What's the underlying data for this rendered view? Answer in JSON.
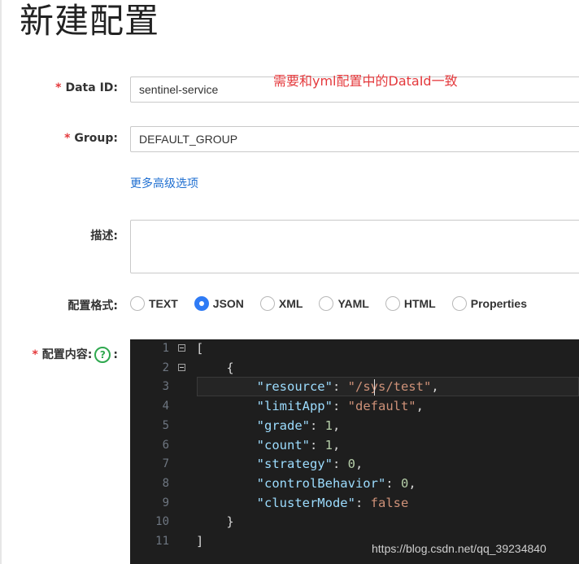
{
  "page": {
    "title": "新建配置"
  },
  "form": {
    "data_id": {
      "label": "Data ID:",
      "value": "sentinel-service"
    },
    "annotation": "需要和yml配置中的DataId一致",
    "group": {
      "label": "Group:",
      "value": "DEFAULT_GROUP"
    },
    "advanced_link": "更多高级选项",
    "description": {
      "label": "描述:",
      "value": ""
    },
    "format": {
      "label": "配置格式:",
      "selected": "JSON",
      "options": [
        "TEXT",
        "JSON",
        "XML",
        "YAML",
        "HTML",
        "Properties"
      ]
    },
    "content": {
      "label": "配置内容:",
      "help": "?",
      "colon": ":"
    }
  },
  "editor": {
    "line_numbers": [
      "1",
      "2",
      "3",
      "4",
      "5",
      "6",
      "7",
      "8",
      "9",
      "10",
      "11"
    ],
    "lines": [
      [
        {
          "t": "[",
          "c": "punc"
        }
      ],
      [
        {
          "t": "    {",
          "c": "punc"
        }
      ],
      [
        {
          "t": "        ",
          "c": "punc"
        },
        {
          "t": "\"resource\"",
          "c": "key"
        },
        {
          "t": ": ",
          "c": "punc"
        },
        {
          "t": "\"/sys/test\"",
          "c": "str"
        },
        {
          "t": ",",
          "c": "punc"
        }
      ],
      [
        {
          "t": "        ",
          "c": "punc"
        },
        {
          "t": "\"limitApp\"",
          "c": "key"
        },
        {
          "t": ": ",
          "c": "punc"
        },
        {
          "t": "\"default\"",
          "c": "str"
        },
        {
          "t": ",",
          "c": "punc"
        }
      ],
      [
        {
          "t": "        ",
          "c": "punc"
        },
        {
          "t": "\"grade\"",
          "c": "key"
        },
        {
          "t": ": ",
          "c": "punc"
        },
        {
          "t": "1",
          "c": "num"
        },
        {
          "t": ",",
          "c": "punc"
        }
      ],
      [
        {
          "t": "        ",
          "c": "punc"
        },
        {
          "t": "\"count\"",
          "c": "key"
        },
        {
          "t": ": ",
          "c": "punc"
        },
        {
          "t": "1",
          "c": "num"
        },
        {
          "t": ",",
          "c": "punc"
        }
      ],
      [
        {
          "t": "        ",
          "c": "punc"
        },
        {
          "t": "\"strategy\"",
          "c": "key"
        },
        {
          "t": ": ",
          "c": "punc"
        },
        {
          "t": "0",
          "c": "num"
        },
        {
          "t": ",",
          "c": "punc"
        }
      ],
      [
        {
          "t": "        ",
          "c": "punc"
        },
        {
          "t": "\"controlBehavior\"",
          "c": "key"
        },
        {
          "t": ": ",
          "c": "punc"
        },
        {
          "t": "0",
          "c": "num"
        },
        {
          "t": ",",
          "c": "punc"
        }
      ],
      [
        {
          "t": "        ",
          "c": "punc"
        },
        {
          "t": "\"clusterMode\"",
          "c": "key"
        },
        {
          "t": ": ",
          "c": "punc"
        },
        {
          "t": "false",
          "c": "bool"
        }
      ],
      [
        {
          "t": "    }",
          "c": "punc"
        }
      ],
      [
        {
          "t": "]",
          "c": "punc"
        }
      ]
    ],
    "foldable_lines": [
      1,
      2
    ],
    "colors": {
      "background": "#1e1e1e",
      "key": "#9cdcfe",
      "string": "#ce9178",
      "number": "#b5cea8"
    }
  },
  "watermark": "https://blog.csdn.net/qq_39234840"
}
